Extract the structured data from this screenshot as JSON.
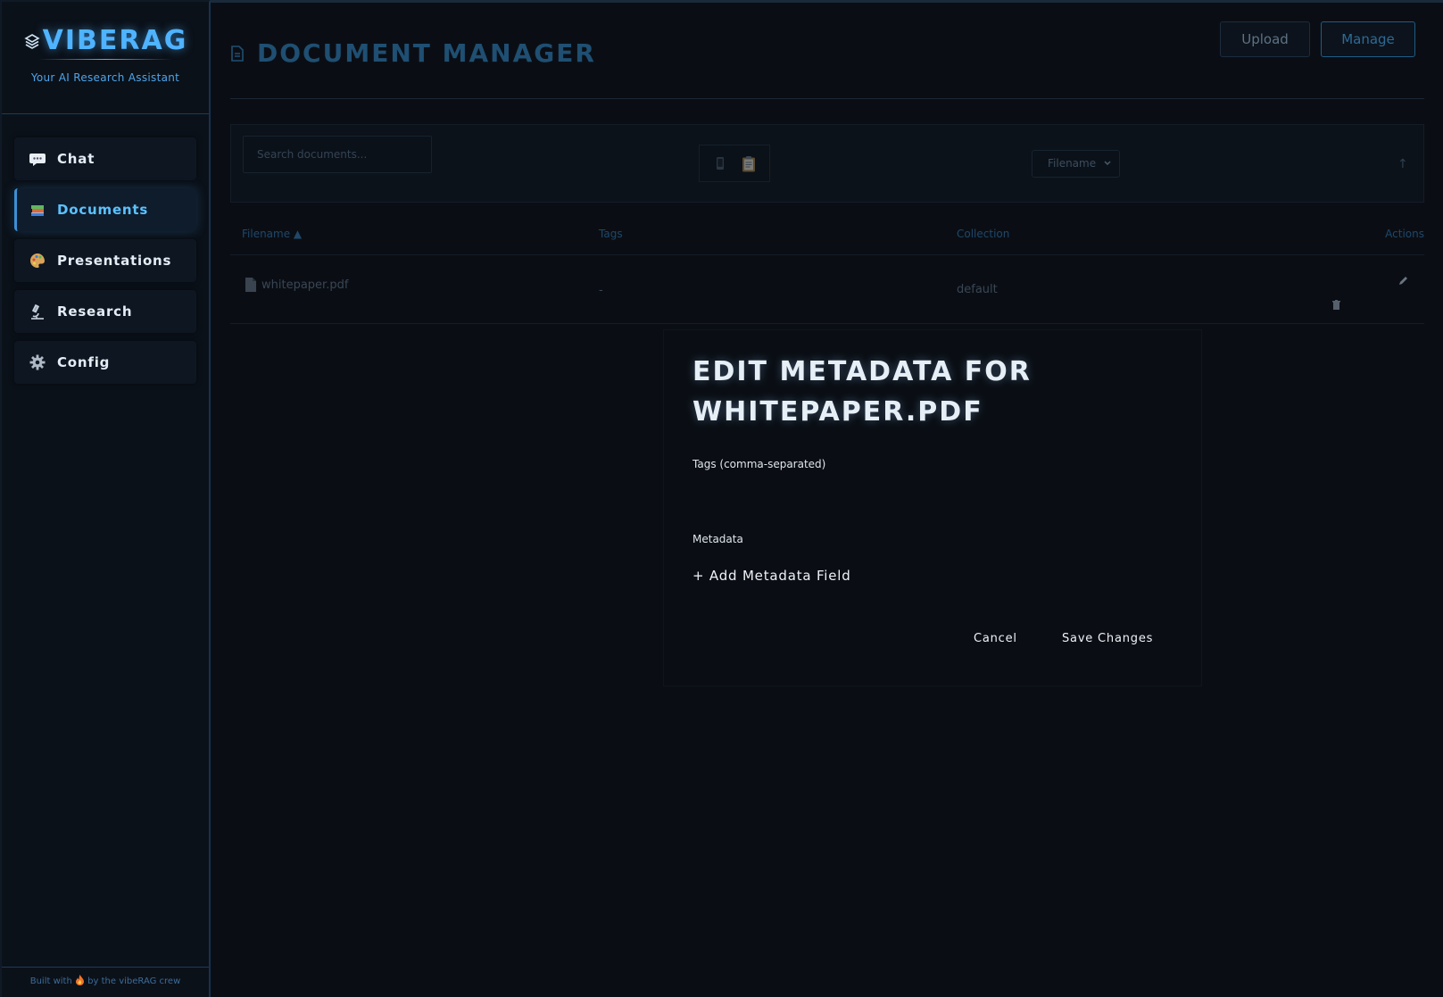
{
  "brand": {
    "name": "VIBERAG",
    "tagline": "Your AI Research Assistant",
    "accent": "#4fb3ff"
  },
  "sidebar": {
    "items": [
      {
        "label": "Chat",
        "icon": "speech-bubble-icon",
        "active": false
      },
      {
        "label": "Documents",
        "icon": "books-icon",
        "active": true
      },
      {
        "label": "Presentations",
        "icon": "palette-icon",
        "active": false
      },
      {
        "label": "Research",
        "icon": "microscope-icon",
        "active": false
      },
      {
        "label": "Config",
        "icon": "gear-icon",
        "active": false
      }
    ],
    "footer": {
      "prefix": "Built with",
      "icon": "fire-icon",
      "suffix": "by the vibeRAG crew"
    }
  },
  "header": {
    "title": "DOCUMENT MANAGER",
    "upload_label": "Upload",
    "manage_label": "Manage"
  },
  "toolbar": {
    "search_placeholder": "Search documents...",
    "sort_value": "Filename",
    "sort_direction": "↑"
  },
  "table": {
    "columns": [
      "Filename ▲",
      "Tags",
      "Collection",
      "Actions"
    ],
    "rows": [
      {
        "filename": "whitepaper.pdf",
        "tags": "-",
        "collection": "default"
      }
    ]
  },
  "modal": {
    "title": "EDIT METADATA FOR WHITEPAPER.PDF",
    "tags_label": "Tags (comma-separated)",
    "tags_value": "",
    "metadata_label": "Metadata",
    "add_field_label": "+ Add Metadata Field",
    "cancel_label": "Cancel",
    "save_label": "Save Changes"
  }
}
